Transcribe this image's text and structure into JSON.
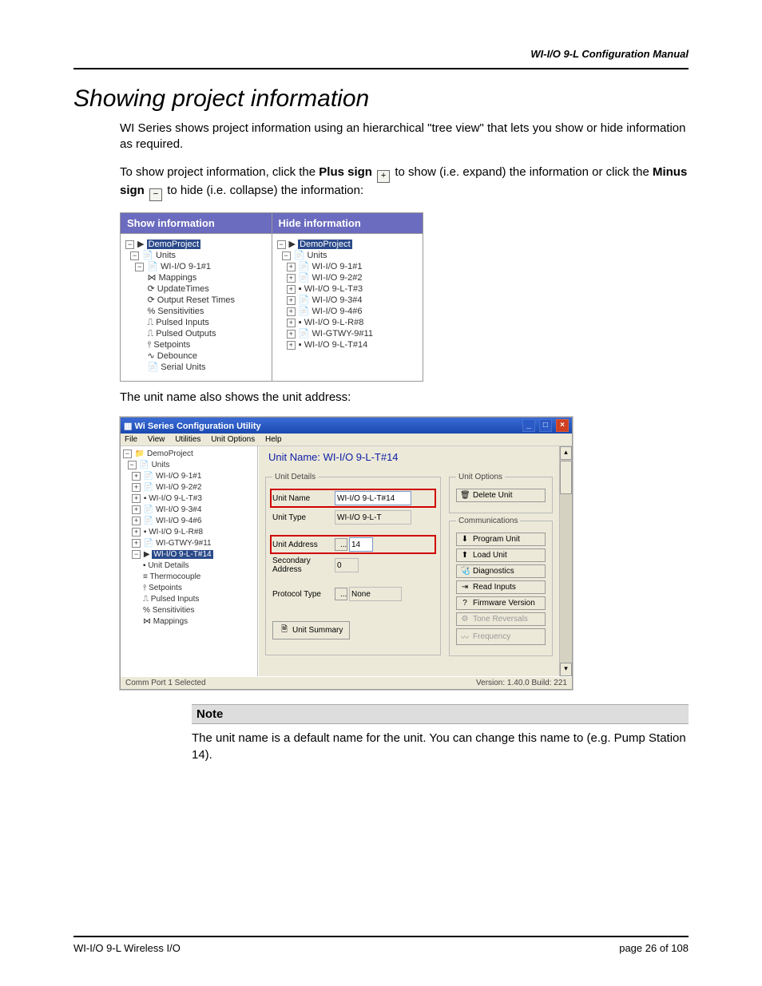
{
  "header_right": "WI-I/O 9-L Configuration Manual",
  "section_title": "Showing project information",
  "intro_para": "WI Series shows project information using an hierarchical \"tree view\" that lets you show or hide information as required.",
  "para2_pre": "To show project information, click the ",
  "para2_plus": "Plus sign",
  "para2_mid": " to show (i.e. expand) the information or click the ",
  "para2_minus": "Minus sign",
  "para2_end": " to hide (i.e. collapse) the information:",
  "table_headers": {
    "show": "Show information",
    "hide": "Hide information"
  },
  "show_tree": {
    "root": "DemoProject",
    "units_label": "Units",
    "items": [
      "WI-I/O 9-1#1",
      "Mappings",
      "UpdateTimes",
      "Output Reset Times",
      "Sensitivities",
      "Pulsed Inputs",
      "Pulsed Outputs",
      "Setpoints",
      "Debounce",
      "Serial Units"
    ]
  },
  "hide_tree": {
    "root": "DemoProject",
    "units_label": "Units",
    "items": [
      "WI-I/O 9-1#1",
      "WI-I/O 9-2#2",
      "WI-I/O 9-L-T#3",
      "WI-I/O 9-3#4",
      "WI-I/O 9-4#6",
      "WI-I/O 9-L-R#8",
      "WI-GTWY-9#11",
      "WI-I/O 9-L-T#14"
    ]
  },
  "after_table_text": "The unit name also shows the unit address:",
  "app": {
    "title": "Wi Series Configuration Utility",
    "menus": [
      "File",
      "View",
      "Utilities",
      "Unit Options",
      "Help"
    ],
    "tree": {
      "root": "DemoProject",
      "units_label": "Units",
      "items": [
        "WI-I/O 9-1#1",
        "WI-I/O 9-2#2",
        "WI-I/O 9-L-T#3",
        "WI-I/O 9-3#4",
        "WI-I/O 9-4#6",
        "WI-I/O 9-L-R#8",
        "WI-GTWY-9#11"
      ],
      "selected": "WI-I/O 9-L-T#14",
      "selected_children": [
        "Unit Details",
        "Thermocouple",
        "Setpoints",
        "Pulsed Inputs",
        "Sensitivities",
        "Mappings"
      ]
    },
    "unit_name_title": "Unit Name: WI-I/O 9-L-T#14",
    "details": {
      "legend": "Unit Details",
      "unit_name_label": "Unit Name",
      "unit_name_value": "WI-I/O 9-L-T#14",
      "unit_type_label": "Unit Type",
      "unit_type_value": "WI-I/O 9-L-T",
      "unit_address_label": "Unit Address",
      "unit_address_value": "14",
      "secondary_address_label": "Secondary Address",
      "secondary_address_value": "0",
      "protocol_type_label": "Protocol Type",
      "protocol_type_value": "None",
      "unit_summary_btn": "Unit Summary"
    },
    "unit_options": {
      "legend": "Unit Options",
      "delete_unit": "Delete Unit"
    },
    "communications": {
      "legend": "Communications",
      "buttons": [
        "Program Unit",
        "Load Unit",
        "Diagnostics",
        "Read Inputs",
        "Firmware Version",
        "Tone Reversals",
        "Frequency"
      ]
    },
    "status_left": "Comm Port 1 Selected",
    "status_right": "Version: 1.40.0 Build: 221"
  },
  "note_label": "Note",
  "note_text": "The unit name is a default name for the unit. You can change this name to  (e.g. Pump Station 14).",
  "footer_left": "WI-I/O 9-L Wireless I/O",
  "footer_right_prefix": "page ",
  "footer_page": "26",
  "footer_of": " of 108"
}
